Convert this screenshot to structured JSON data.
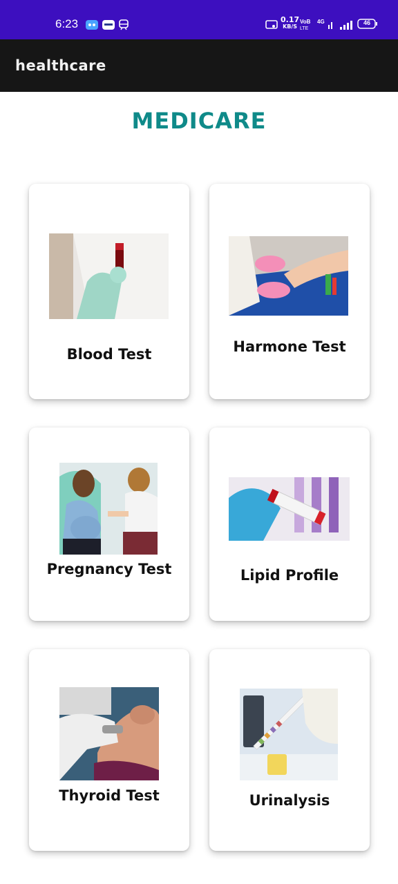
{
  "status_bar": {
    "time": "6:23",
    "network_speed": "0.17",
    "network_unit": "KB/S",
    "battery": "46",
    "background": "#3d0fbf"
  },
  "app_bar": {
    "title": "healthcare",
    "background": "#161616"
  },
  "brand": {
    "title": "MEDICARE",
    "color": "#0f8a89"
  },
  "tests": [
    {
      "label": "Blood Test",
      "icon": "blood-sample-icon"
    },
    {
      "label": "Harmone Test",
      "icon": "blood-draw-icon"
    },
    {
      "label": "Pregnancy Test",
      "icon": "pregnancy-icon"
    },
    {
      "label": "Lipid Profile",
      "icon": "lipid-tube-icon"
    },
    {
      "label": "Thyroid Test",
      "icon": "thyroid-scan-icon"
    },
    {
      "label": "Urinalysis",
      "icon": "urine-strip-icon"
    }
  ]
}
